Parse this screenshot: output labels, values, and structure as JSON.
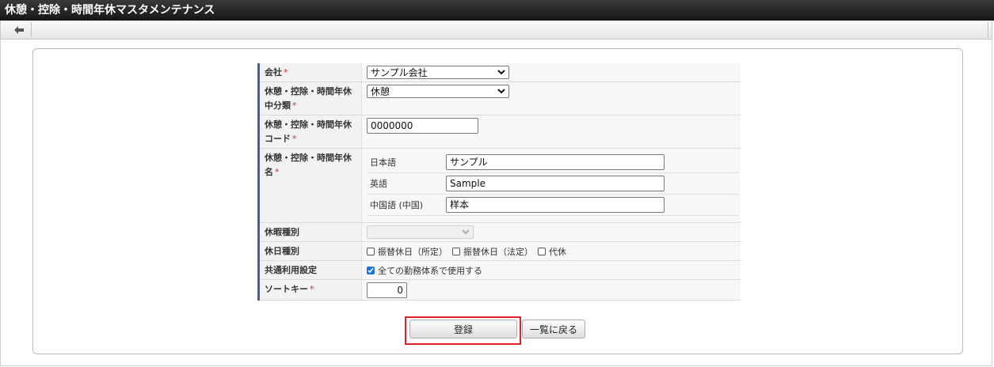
{
  "window": {
    "title": "休憩・控除・時間年休マスタメンテナンス"
  },
  "toolbar": {
    "back_icon": "arrow-left-icon"
  },
  "form": {
    "company": {
      "label": "会社",
      "required_mark": "*",
      "value": "サンプル会社"
    },
    "category": {
      "label": "休憩・控除・時間年休中分類",
      "required_mark": "*",
      "value": "休憩"
    },
    "code": {
      "label": "休憩・控除・時間年休コード",
      "required_mark": "*",
      "value": "0000000"
    },
    "name": {
      "label": "休憩・控除・時間年休名",
      "required_mark": "*",
      "rows": [
        {
          "lang": "日本語",
          "value": "サンプル"
        },
        {
          "lang": "英語",
          "value": "Sample"
        },
        {
          "lang": "中国語 (中国)",
          "value": "样本"
        }
      ]
    },
    "leave_type": {
      "label": "休暇種別",
      "value": ""
    },
    "holiday_type": {
      "label": "休日種別",
      "options": [
        {
          "label": "振替休日（所定）",
          "checked": false
        },
        {
          "label": "振替休日（法定）",
          "checked": false
        },
        {
          "label": "代休",
          "checked": false
        }
      ]
    },
    "shared_use": {
      "label": "共通利用設定",
      "checkbox_label": "全ての勤務体系で使用する",
      "checked": true
    },
    "sort_key": {
      "label": "ソートキー",
      "required_mark": "*",
      "value": "0"
    }
  },
  "buttons": {
    "register": "登録",
    "back_to_list": "一覧に戻る"
  },
  "colors": {
    "accent": "#4a5d9a",
    "required": "#e0263e",
    "highlight": "#e0202a",
    "checkbox": "#1a73e8"
  }
}
